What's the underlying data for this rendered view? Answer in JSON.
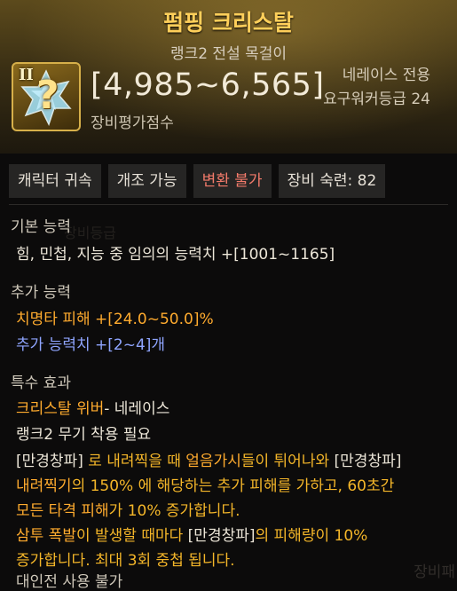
{
  "header": {
    "title": "펌핑 크리스탈",
    "subtitle": "랭크2 전설 목걸이",
    "rank_roman": "II",
    "icon": "question-mark-crystal-icon",
    "icon_glyph": "?",
    "score": "[4,985~6,565]",
    "score_label": "장비평가점수",
    "owner": "네레이스 전용",
    "requirement": "요구워커등급 24"
  },
  "tags": [
    {
      "label": "캐릭터 귀속"
    },
    {
      "label": "개조 가능"
    },
    {
      "label": "변환 불가"
    },
    {
      "label": "장비 숙련: 82"
    }
  ],
  "basic": {
    "title": "기본 능력",
    "line": "힘, 민첩, 지능 중 임의의 능력치 +[1001~1165]"
  },
  "extra": {
    "title": "추가 능력",
    "line1": "치명타 피해  +[24.0~50.0]%",
    "line2": "추가 능력치 +[2~4]개"
  },
  "special": {
    "title": "특수 효과",
    "name": "크리스탈 위버",
    "name_suffix": "- 네레이스",
    "requirement": "랭크2 무기 착용 필요",
    "d1_a": "[만경창파]",
    "d1_b": " 로 내려찍을 때 ",
    "d1_c": "얼음가시",
    "d1_d": "들이 튀어나와 ",
    "d1_e": "[만경창파]",
    "d2_a": "내려찍기",
    "d2_b": "의 150% 에 해당하는 추가 피해를 가하고, 60초간",
    "d3_a": "모든 타격 피해",
    "d3_b": "가 10% 증가합니다.",
    "d4_a": "삼투 폭발",
    "d4_b": "이 발생할 때마다 ",
    "d4_c": "[만경창파]",
    "d4_d": "의 피해량이 10%",
    "d5": "증가합니다. 최대 3회 중첩 됩니다.",
    "pvp": "대인전 사용 불가"
  },
  "watermark": {
    "text1": "장비등급",
    "text2": "장비패"
  },
  "colors": {
    "title": "#ffcf5a",
    "highlight_orange": "#ffab2e",
    "highlight_blue": "#8fa5ff",
    "highlight_gold": "#f4b629",
    "warning_red": "#f27a6a"
  }
}
